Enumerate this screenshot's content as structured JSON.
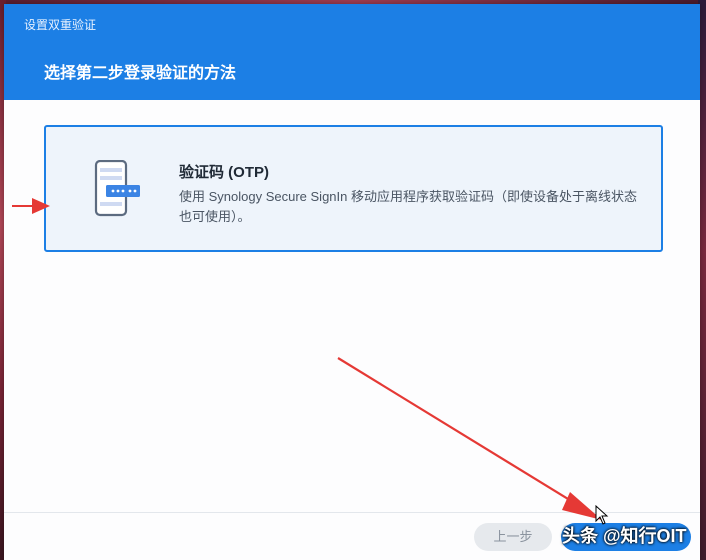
{
  "dialog": {
    "window_title": "设置双重验证",
    "step_title": "选择第二步登录验证的方法"
  },
  "option": {
    "icon": "phone-otp-icon",
    "title": "验证码 (OTP)",
    "description": "使用 Synology Secure SignIn 移动应用程序获取验证码（即使设备处于离线状态也可使用）。"
  },
  "footer": {
    "prev_label": "上一步"
  },
  "watermark": "头条 @知行OIT",
  "colors": {
    "accent": "#1c7fe5",
    "annotation_arrow": "#e53935"
  }
}
